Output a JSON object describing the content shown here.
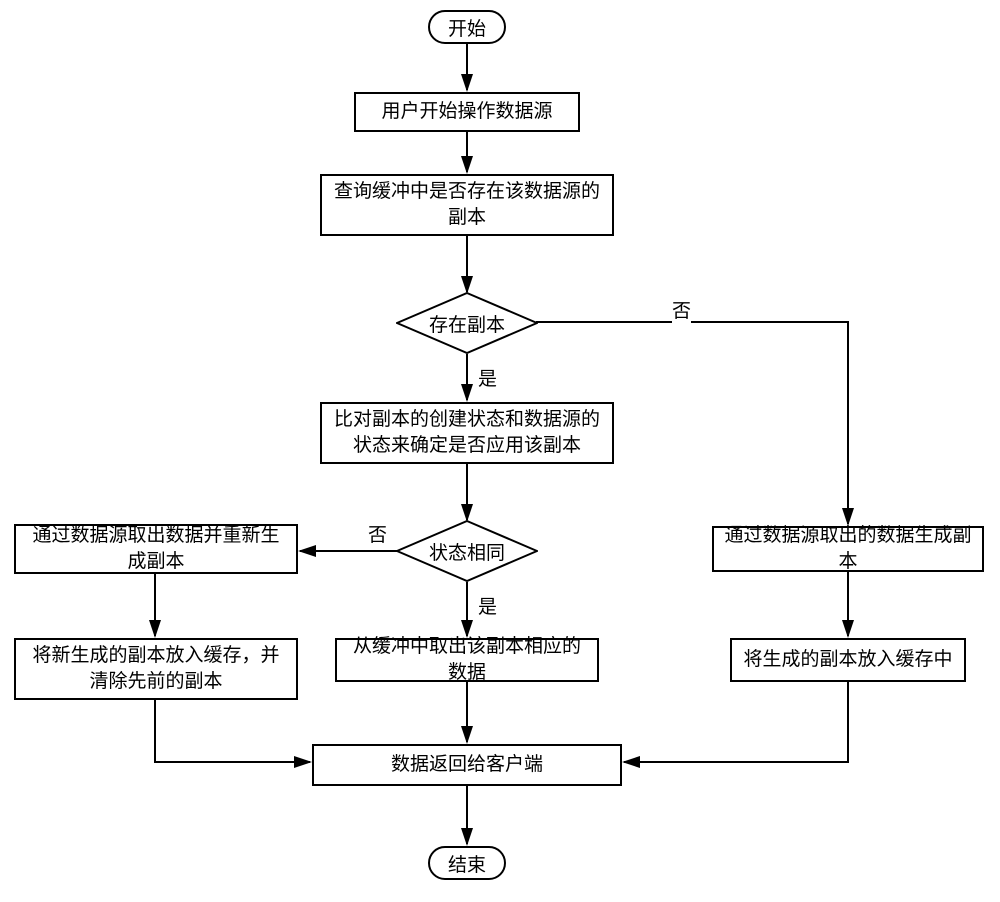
{
  "chart_data": {
    "type": "flowchart",
    "title": "",
    "nodes": [
      {
        "id": "start",
        "type": "terminator",
        "label": "开始"
      },
      {
        "id": "p1",
        "type": "process",
        "label": "用户开始操作数据源"
      },
      {
        "id": "p2",
        "type": "process",
        "label": "查询缓冲中是否存在该数据源的副本"
      },
      {
        "id": "d1",
        "type": "decision",
        "label": "存在副本"
      },
      {
        "id": "p3",
        "type": "process",
        "label": "比对副本的创建状态和数据源的状态来确定是否应用该副本"
      },
      {
        "id": "d2",
        "type": "decision",
        "label": "状态相同"
      },
      {
        "id": "p4",
        "type": "process",
        "label": "通过数据源取出数据并重新生成副本"
      },
      {
        "id": "p5",
        "type": "process",
        "label": "将新生成的副本放入缓存，并清除先前的副本"
      },
      {
        "id": "p6",
        "type": "process",
        "label": "从缓冲中取出该副本相应的数据"
      },
      {
        "id": "p7",
        "type": "process",
        "label": "通过数据源取出的数据生成副本"
      },
      {
        "id": "p8",
        "type": "process",
        "label": "将生成的副本放入缓存中"
      },
      {
        "id": "p9",
        "type": "process",
        "label": "数据返回给客户端"
      },
      {
        "id": "end",
        "type": "terminator",
        "label": "结束"
      }
    ],
    "edges": [
      {
        "from": "start",
        "to": "p1"
      },
      {
        "from": "p1",
        "to": "p2"
      },
      {
        "from": "p2",
        "to": "d1"
      },
      {
        "from": "d1",
        "to": "p3",
        "label": "是"
      },
      {
        "from": "d1",
        "to": "p7",
        "label": "否"
      },
      {
        "from": "p3",
        "to": "d2"
      },
      {
        "from": "d2",
        "to": "p6",
        "label": "是"
      },
      {
        "from": "d2",
        "to": "p4",
        "label": "否"
      },
      {
        "from": "p4",
        "to": "p5"
      },
      {
        "from": "p5",
        "to": "p9"
      },
      {
        "from": "p6",
        "to": "p9"
      },
      {
        "from": "p7",
        "to": "p8"
      },
      {
        "from": "p8",
        "to": "p9"
      },
      {
        "from": "p9",
        "to": "end"
      }
    ],
    "edge_labels": {
      "yes": "是",
      "no": "否"
    }
  }
}
